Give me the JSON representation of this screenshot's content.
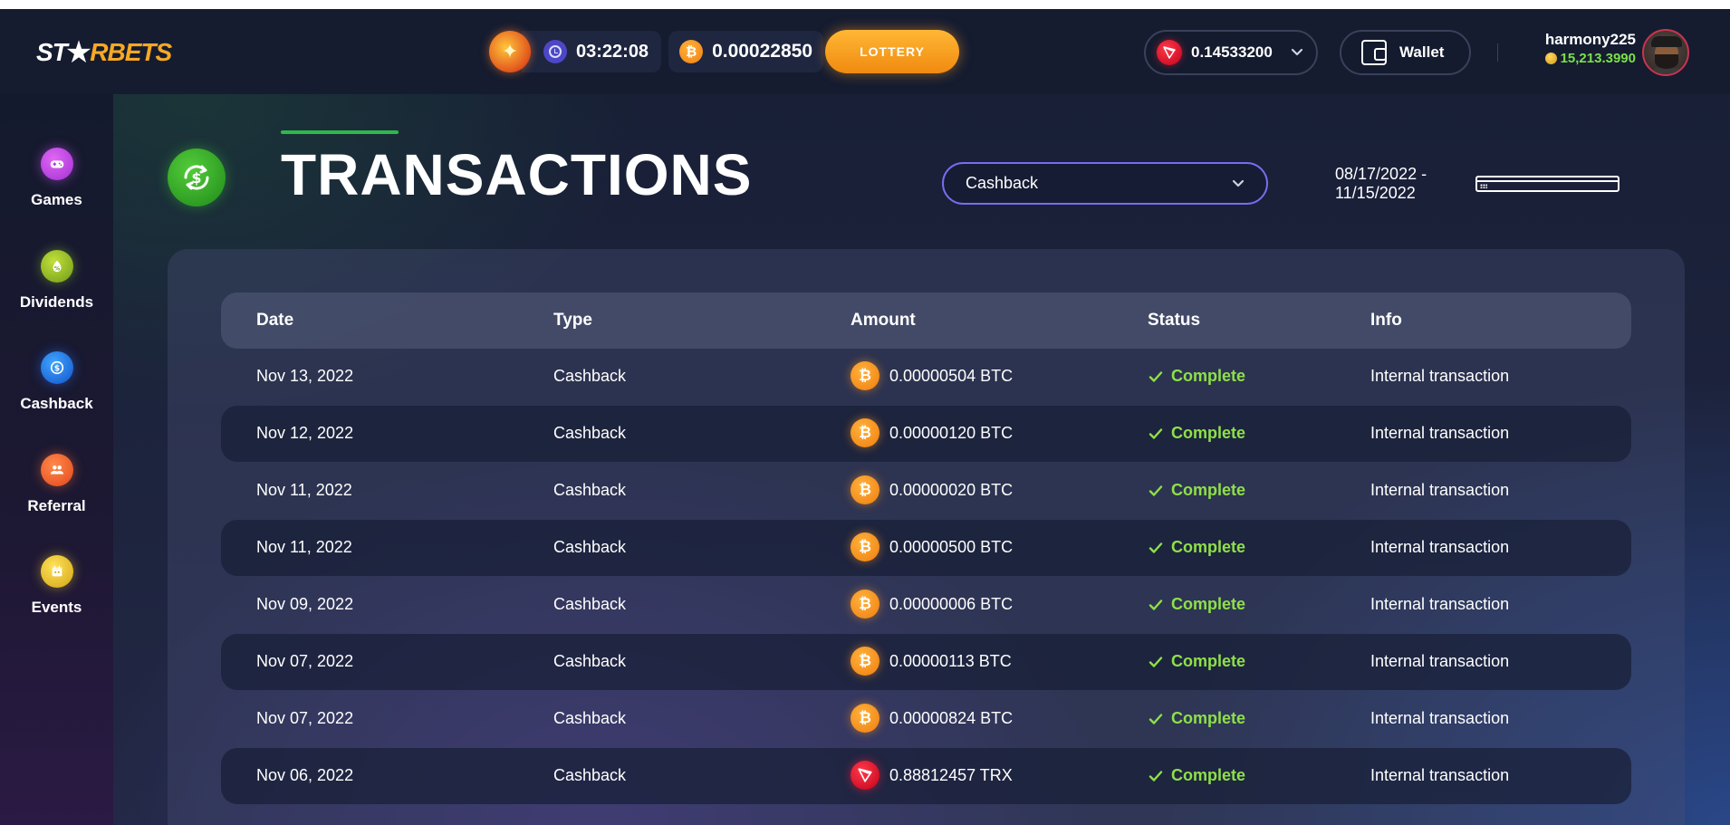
{
  "header": {
    "logo": {
      "part1": "ST",
      "part2": "R",
      "part3": "BETS"
    },
    "timer": "03:22:08",
    "btc_balance": "0.00022850",
    "lottery_label": "LOTTERY",
    "currency_value": "0.14533200",
    "wallet_label": "Wallet",
    "username": "harmony225",
    "coins": "15,213.3990"
  },
  "sidebar": {
    "items": [
      {
        "label": "Games",
        "icon": "gamepad-icon"
      },
      {
        "label": "Dividends",
        "icon": "dividends-icon"
      },
      {
        "label": "Cashback",
        "icon": "cashback-icon"
      },
      {
        "label": "Referral",
        "icon": "referral-icon"
      },
      {
        "label": "Events",
        "icon": "events-icon"
      }
    ]
  },
  "page": {
    "title": "TRANSACTIONS",
    "filter_value": "Cashback",
    "date_range": "08/17/2022 - 11/15/2022"
  },
  "table": {
    "columns": [
      "Date",
      "Type",
      "Amount",
      "Status",
      "Info"
    ],
    "rows": [
      {
        "date": "Nov 13, 2022",
        "type": "Cashback",
        "coin": "btc",
        "amount": "0.00000504 BTC",
        "status": "Complete",
        "info": "Internal transaction"
      },
      {
        "date": "Nov 12, 2022",
        "type": "Cashback",
        "coin": "btc",
        "amount": "0.00000120 BTC",
        "status": "Complete",
        "info": "Internal transaction"
      },
      {
        "date": "Nov 11, 2022",
        "type": "Cashback",
        "coin": "btc",
        "amount": "0.00000020 BTC",
        "status": "Complete",
        "info": "Internal transaction"
      },
      {
        "date": "Nov 11, 2022",
        "type": "Cashback",
        "coin": "btc",
        "amount": "0.00000500 BTC",
        "status": "Complete",
        "info": "Internal transaction"
      },
      {
        "date": "Nov 09, 2022",
        "type": "Cashback",
        "coin": "btc",
        "amount": "0.00000006 BTC",
        "status": "Complete",
        "info": "Internal transaction"
      },
      {
        "date": "Nov 07, 2022",
        "type": "Cashback",
        "coin": "btc",
        "amount": "0.00000113 BTC",
        "status": "Complete",
        "info": "Internal transaction"
      },
      {
        "date": "Nov 07, 2022",
        "type": "Cashback",
        "coin": "btc",
        "amount": "0.00000824 BTC",
        "status": "Complete",
        "info": "Internal transaction"
      },
      {
        "date": "Nov 06, 2022",
        "type": "Cashback",
        "coin": "trx",
        "amount": "0.88812457 TRX",
        "status": "Complete",
        "info": "Internal transaction"
      }
    ]
  },
  "colors": {
    "accent_orange": "#f7a824",
    "status_green": "#8ee048",
    "filter_border": "#7a6cf0",
    "title_green": "#2fb84a"
  }
}
